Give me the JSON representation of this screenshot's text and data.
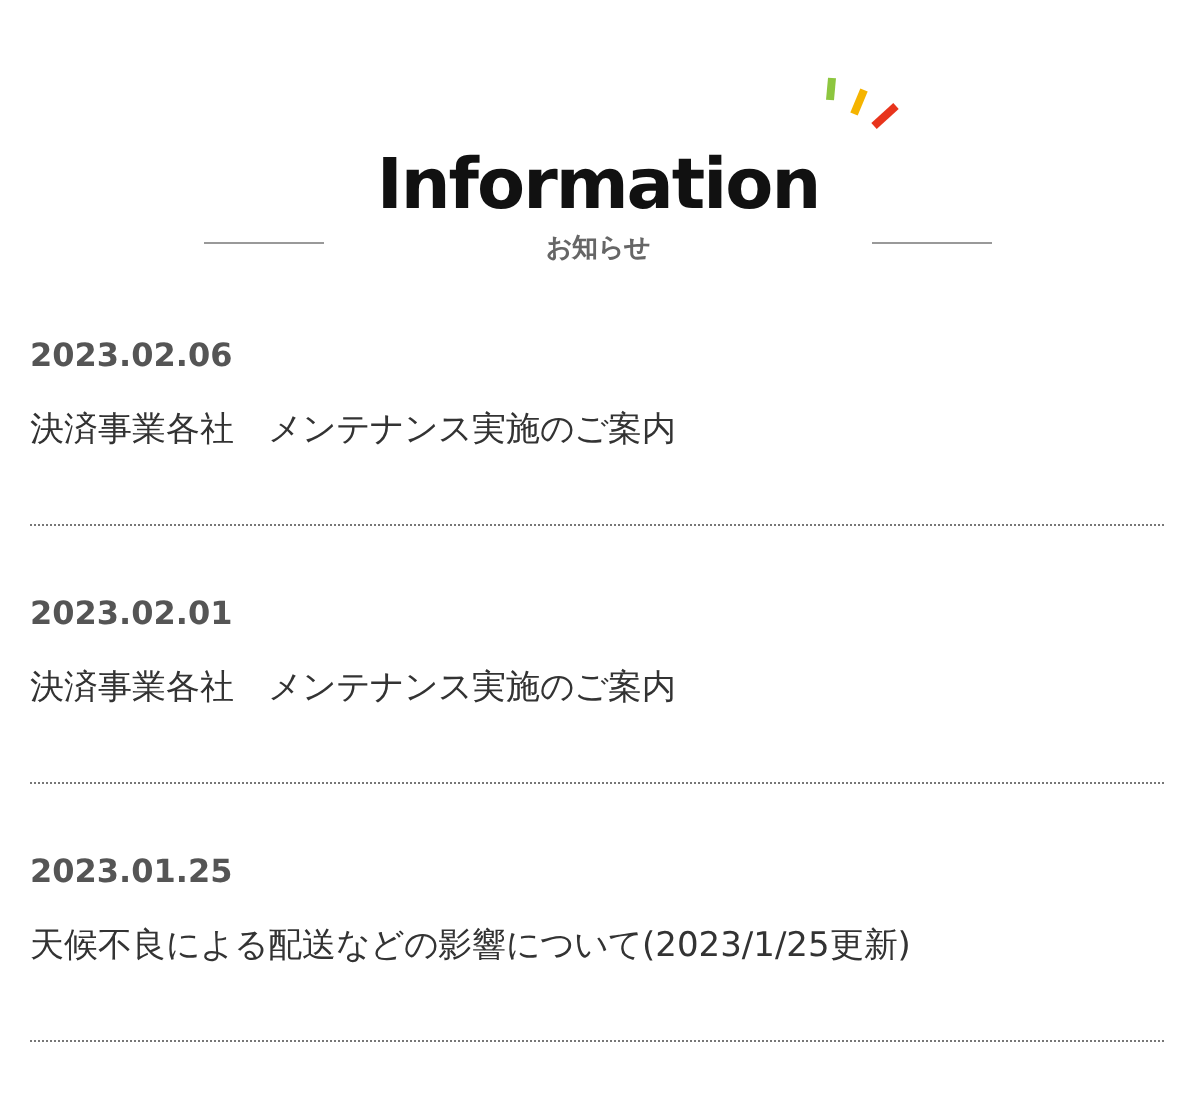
{
  "heading": {
    "title": "Information",
    "subtitle": "お知らせ"
  },
  "news": [
    {
      "date": "2023.02.06",
      "title": "決済事業各社　メンテナンス実施のご案内"
    },
    {
      "date": "2023.02.01",
      "title": "決済事業各社　メンテナンス実施のご案内"
    },
    {
      "date": "2023.01.25",
      "title": "天候不良による配送などの影響について(2023/1/25更新)"
    }
  ]
}
